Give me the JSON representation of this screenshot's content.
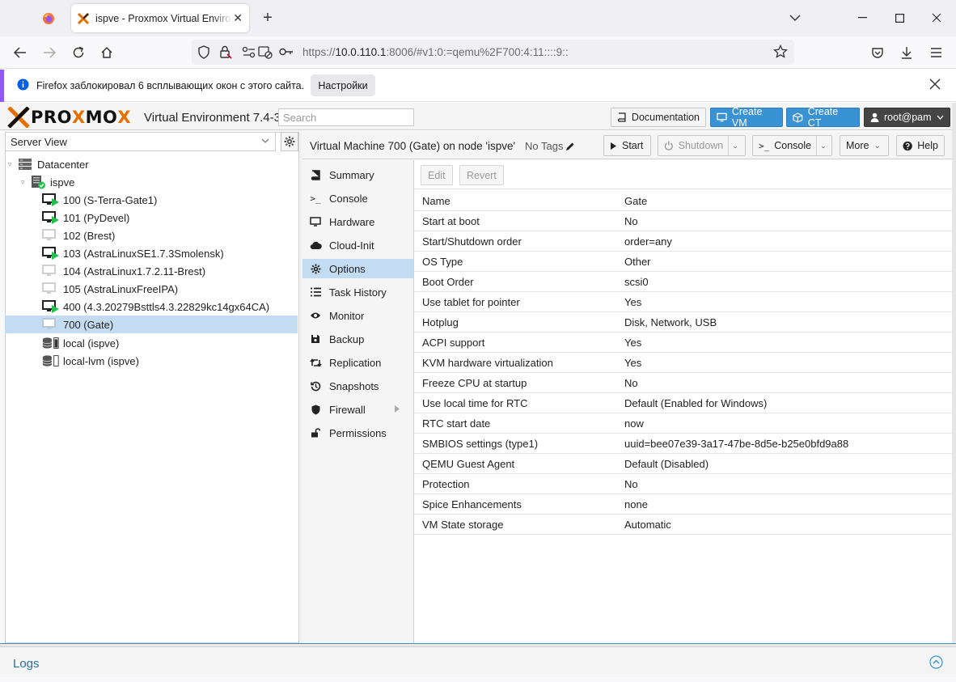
{
  "browser": {
    "tab_title": "ispve - Proxmox Virtual Environment",
    "new_tab": "+",
    "url_prefix": "https://",
    "url_host": "10.0.110.1",
    "url_rest": ":8006/#v1:0:=qemu%2F700:4:11::::9::",
    "notification_text": "Firefox заблокировал 6 всплывающих окон с этого сайта.",
    "notification_button": "Настройки"
  },
  "header": {
    "logo_letters": [
      "P",
      "R",
      "O",
      "X",
      "M",
      "O",
      "X"
    ],
    "version": "Virtual Environment 7.4-3",
    "search_placeholder": "Search",
    "documentation": "Documentation",
    "create_vm": "Create VM",
    "create_ct": "Create CT",
    "user": "root@pam",
    "accent_color": "#3892d4",
    "logo_orange": "#e57000"
  },
  "left": {
    "view_label": "Server View",
    "tree": [
      {
        "label": "Datacenter",
        "icon": "datacenter-icon",
        "level": 0
      },
      {
        "label": "ispve",
        "icon": "node-icon",
        "level": 1
      },
      {
        "label": "100 (S-Terra-Gate1)",
        "icon": "vm-running-icon",
        "level": 2
      },
      {
        "label": "101 (PyDevel)",
        "icon": "vm-running-icon",
        "level": 2
      },
      {
        "label": "102 (Brest)",
        "icon": "vm-stopped-icon",
        "level": 2
      },
      {
        "label": "103 (AstraLinuxSE1.7.3Smolensk)",
        "icon": "vm-running-icon",
        "level": 2
      },
      {
        "label": "104 (AstraLinux1.7.2.11-Brest)",
        "icon": "vm-stopped-icon",
        "level": 2
      },
      {
        "label": "105 (AstraLinuxFreeIPA)",
        "icon": "vm-stopped-icon",
        "level": 2
      },
      {
        "label": "400 (4.3.20279Bsttls4.3.22829kc14gx64CA)",
        "icon": "vm-running-icon",
        "level": 2
      },
      {
        "label": "700 (Gate)",
        "icon": "vm-stopped-icon",
        "level": 2,
        "selected": true
      },
      {
        "label": "local (ispve)",
        "icon": "storage-icon",
        "level": 2
      },
      {
        "label": "local-lvm (ispve)",
        "icon": "storage-icon",
        "level": 2
      }
    ]
  },
  "content": {
    "title": "Virtual Machine 700 (Gate) on node 'ispve'",
    "tags": "No Tags",
    "buttons": {
      "start": "Start",
      "shutdown": "Shutdown",
      "console": "Console",
      "more": "More",
      "help": "Help"
    },
    "menu": [
      {
        "label": "Summary",
        "icon": "book-icon"
      },
      {
        "label": "Console",
        "icon": "terminal-icon"
      },
      {
        "label": "Hardware",
        "icon": "desktop-icon"
      },
      {
        "label": "Cloud-Init",
        "icon": "cloud-icon"
      },
      {
        "label": "Options",
        "icon": "gear-icon",
        "selected": true
      },
      {
        "label": "Task History",
        "icon": "list-icon"
      },
      {
        "label": "Monitor",
        "icon": "eye-icon"
      },
      {
        "label": "Backup",
        "icon": "floppy-icon"
      },
      {
        "label": "Replication",
        "icon": "retweet-icon"
      },
      {
        "label": "Snapshots",
        "icon": "history-icon"
      },
      {
        "label": "Firewall",
        "icon": "shield-icon",
        "has_arrow": true
      },
      {
        "label": "Permissions",
        "icon": "unlock-icon"
      }
    ],
    "grid_buttons": {
      "edit": "Edit",
      "revert": "Revert"
    },
    "options": [
      {
        "k": "Name",
        "v": "Gate"
      },
      {
        "k": "Start at boot",
        "v": "No"
      },
      {
        "k": "Start/Shutdown order",
        "v": "order=any"
      },
      {
        "k": "OS Type",
        "v": "Other"
      },
      {
        "k": "Boot Order",
        "v": "scsi0"
      },
      {
        "k": "Use tablet for pointer",
        "v": "Yes"
      },
      {
        "k": "Hotplug",
        "v": "Disk, Network, USB"
      },
      {
        "k": "ACPI support",
        "v": "Yes"
      },
      {
        "k": "KVM hardware virtualization",
        "v": "Yes"
      },
      {
        "k": "Freeze CPU at startup",
        "v": "No"
      },
      {
        "k": "Use local time for RTC",
        "v": "Default (Enabled for Windows)"
      },
      {
        "k": "RTC start date",
        "v": "now"
      },
      {
        "k": "SMBIOS settings (type1)",
        "v": "uuid=bee07e39-3a17-47be-8d5e-b25e0bfd9a88"
      },
      {
        "k": "QEMU Guest Agent",
        "v": "Default (Disabled)"
      },
      {
        "k": "Protection",
        "v": "No"
      },
      {
        "k": "Spice Enhancements",
        "v": "none"
      },
      {
        "k": "VM State storage",
        "v": "Automatic"
      }
    ]
  },
  "logs": {
    "label": "Logs"
  }
}
